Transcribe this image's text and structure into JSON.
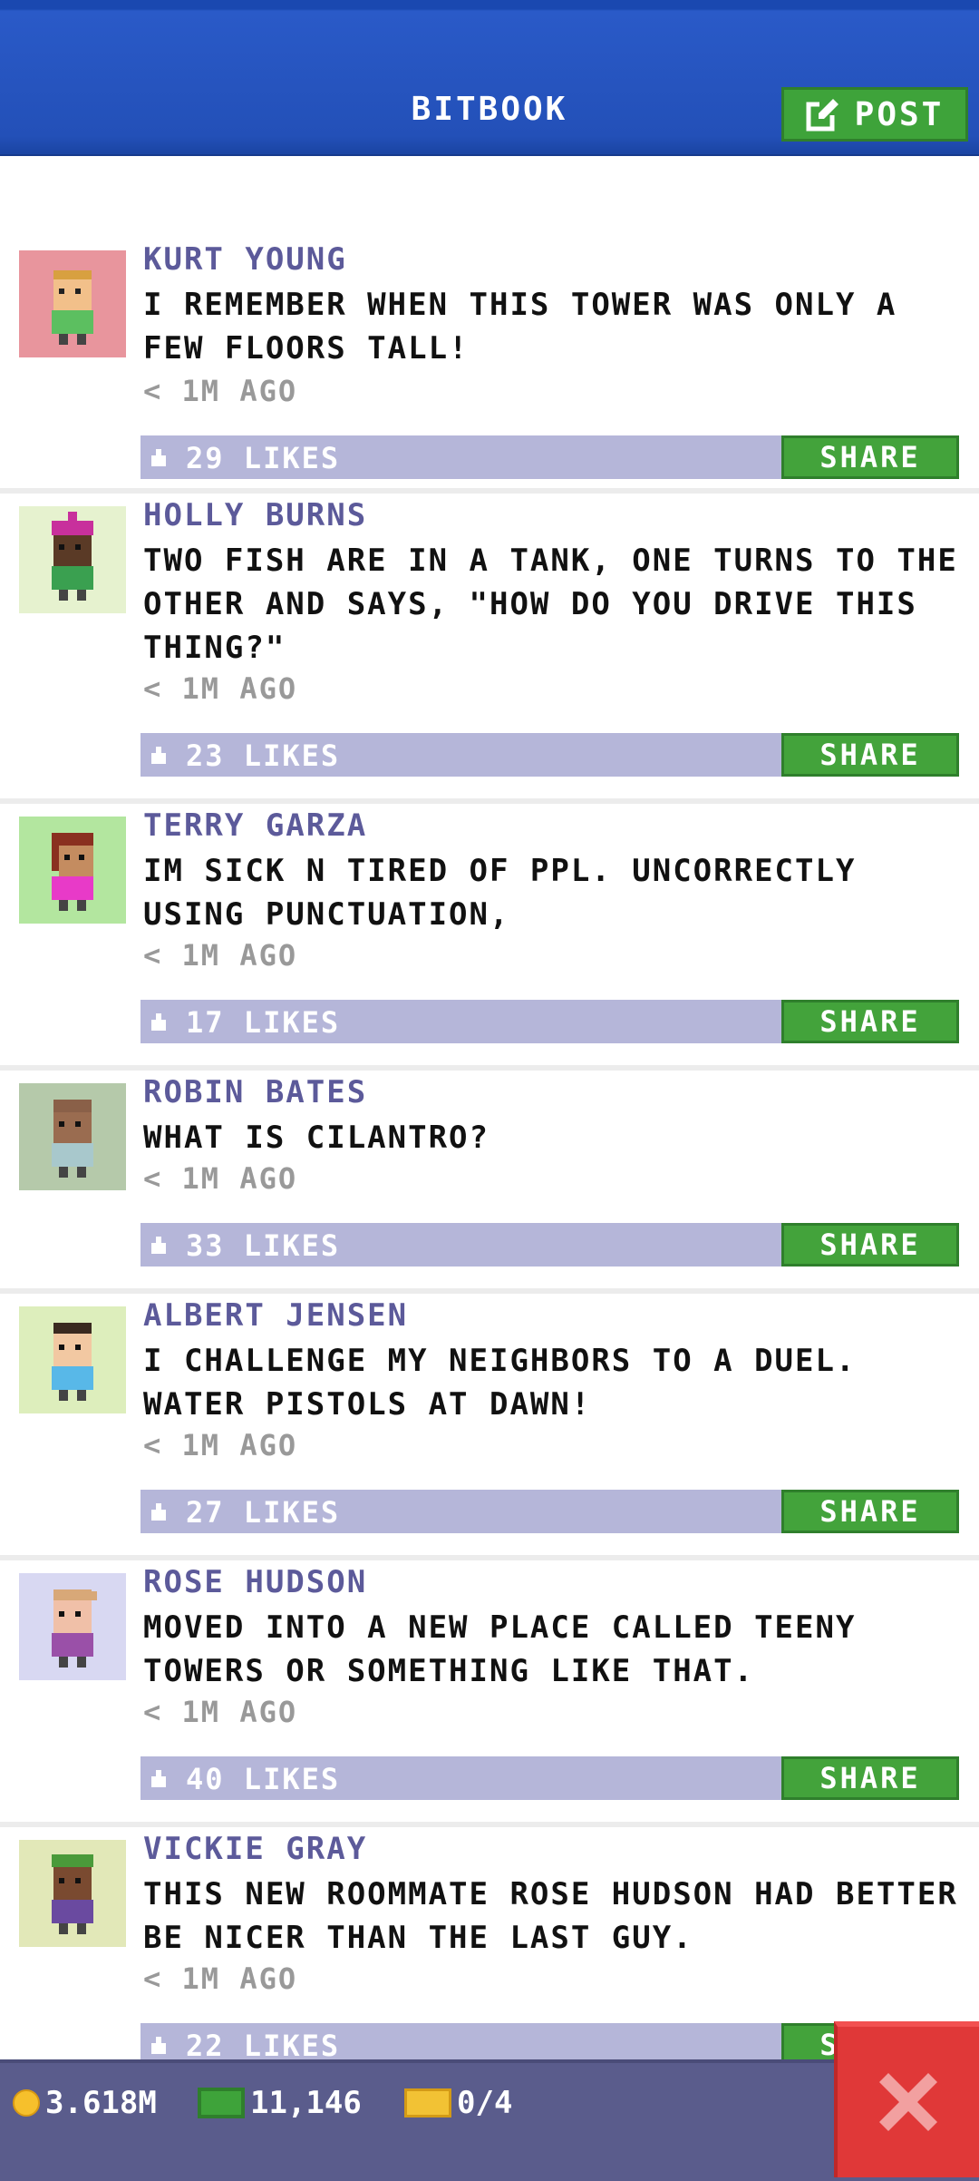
{
  "header": {
    "title": "BITBOOK",
    "post_label": "POST"
  },
  "colors": {
    "header_blue": "#2350b8",
    "name_purple": "#5c5a9a",
    "likes_bar": "#b5b6d9",
    "share_green": "#43a33b",
    "bottom_bar": "#5a5c8c",
    "close_red": "#e03838"
  },
  "posts": [
    {
      "name": "KURT YOUNG",
      "text": "I REMEMBER WHEN THIS TOWER WAS ONLY A FEW FLOORS TALL!",
      "time": "< 1M AGO",
      "likes": "29 LIKES",
      "share": "SHARE",
      "avatar_bg": "#e8959d",
      "hair": "#d8a040",
      "skin": "#f2c08a",
      "shirt": "#5cbf60"
    },
    {
      "name": "HOLLY BURNS",
      "text": "TWO FISH ARE IN A TANK, ONE TURNS TO THE OTHER AND SAYS, \"HOW DO YOU DRIVE THIS THING?\"",
      "time": "< 1M AGO",
      "likes": "23 LIKES",
      "share": "SHARE",
      "avatar_bg": "#e6f2cf",
      "hair": "#c8309c",
      "skin": "#5a3a26",
      "shirt": "#3aa050"
    },
    {
      "name": "TERRY GARZA",
      "text": "IM SICK N TIRED OF PPL. UNCORRECTLY USING PUNCTUATION,",
      "time": "< 1M AGO",
      "likes": "17 LIKES",
      "share": "SHARE",
      "avatar_bg": "#b3e69f",
      "hair": "#8a3020",
      "skin": "#c48c60",
      "shirt": "#e83ac8"
    },
    {
      "name": "ROBIN BATES",
      "text": "WHAT IS CILANTRO?",
      "time": "< 1M AGO",
      "likes": "33 LIKES",
      "share": "SHARE",
      "avatar_bg": "#b5c9aa",
      "hair": "#8a6048",
      "skin": "#9a6c50",
      "shirt": "#a8c8cc"
    },
    {
      "name": "ALBERT JENSEN",
      "text": "I CHALLENGE MY NEIGHBORS TO A DUEL. WATER PISTOLS AT DAWN!",
      "time": "< 1M AGO",
      "likes": "27 LIKES",
      "share": "SHARE",
      "avatar_bg": "#ddeebc",
      "hair": "#3a2a20",
      "skin": "#f2c8a2",
      "shirt": "#58b8e8"
    },
    {
      "name": "ROSE HUDSON",
      "text": "MOVED INTO A NEW PLACE CALLED TEENY TOWERS OR SOMETHING LIKE THAT.",
      "time": "< 1M AGO",
      "likes": "40 LIKES",
      "share": "SHARE",
      "avatar_bg": "#d8d8f2",
      "hair": "#d8a878",
      "skin": "#f0c0a8",
      "shirt": "#9a50a8"
    },
    {
      "name": "VICKIE GRAY",
      "text": "THIS NEW ROOMMATE ROSE HUDSON HAD BETTER BE NICER THAN THE LAST GUY.",
      "time": "< 1M AGO",
      "likes": "22 LIKES",
      "share": "SHARE",
      "avatar_bg": "#e2e8b8",
      "hair": "#4a9a3a",
      "skin": "#7a4a30",
      "shirt": "#6a4aa0"
    }
  ],
  "bottom": {
    "coins": "3.618M",
    "cash": "11,146",
    "tickets": "0/4"
  }
}
